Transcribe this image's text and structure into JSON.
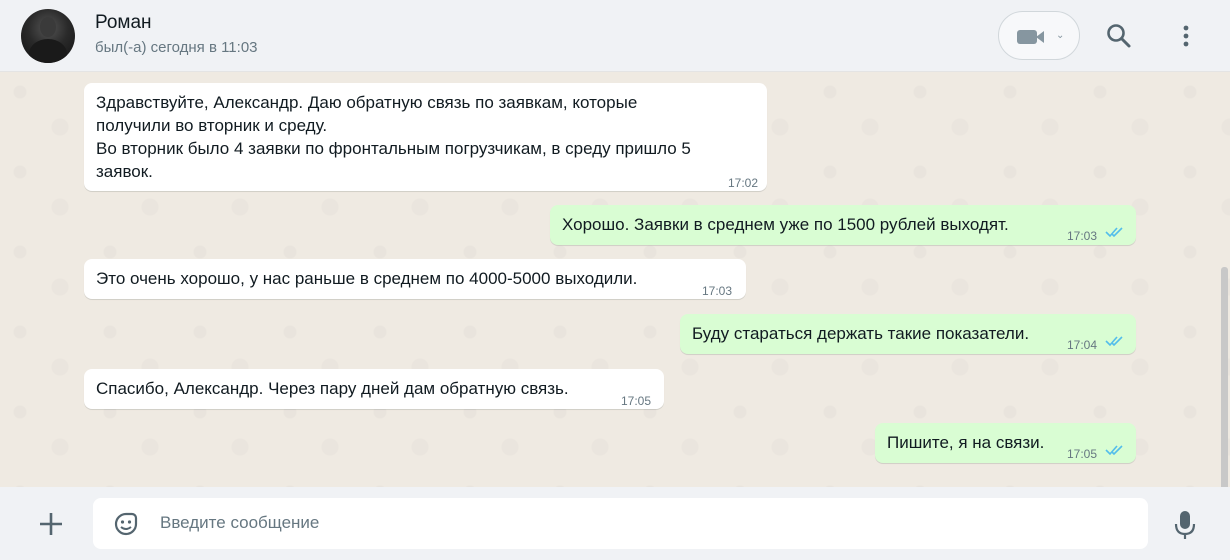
{
  "header": {
    "contact_name": "Роман",
    "contact_status": "был(-а) сегодня в 11:03"
  },
  "messages": [
    {
      "direction": "in",
      "text": "Здравствуйте, Александр. Даю обратную связь по заявкам, которые\nполучили во вторник и среду.\nВо вторник было 4 заявки по фронтальным погрузчикам, в среду пришло 5\nзаявок.",
      "time": "17:02"
    },
    {
      "direction": "out",
      "text": "Хорошо. Заявки в среднем уже по 1500 рублей выходят.",
      "time": "17:03",
      "status": "read"
    },
    {
      "direction": "in",
      "text": "Это очень хорошо, у нас раньше в среднем по 4000-5000 выходили.",
      "time": "17:03"
    },
    {
      "direction": "out",
      "text": "Буду стараться держать такие показатели.",
      "time": "17:04",
      "status": "read"
    },
    {
      "direction": "in",
      "text": "Спасибо, Александр. Через пару дней дам обратную связь.",
      "time": "17:05"
    },
    {
      "direction": "out",
      "text": "Пишите, я на связи.",
      "time": "17:05",
      "status": "read"
    }
  ],
  "composer": {
    "placeholder": "Введите сообщение",
    "value": ""
  },
  "colors": {
    "chat_bg": "#efeae2",
    "incoming_bubble": "#ffffff",
    "outgoing_bubble": "#d9fdd3",
    "read_tick": "#53bdeb",
    "header_bg": "#f0f2f5"
  },
  "icons": {
    "video": "video-camera-icon",
    "search": "search-icon",
    "menu": "vertical-dots-icon",
    "attach": "plus-icon",
    "emoji": "sticker-icon",
    "voice": "microphone-icon"
  }
}
